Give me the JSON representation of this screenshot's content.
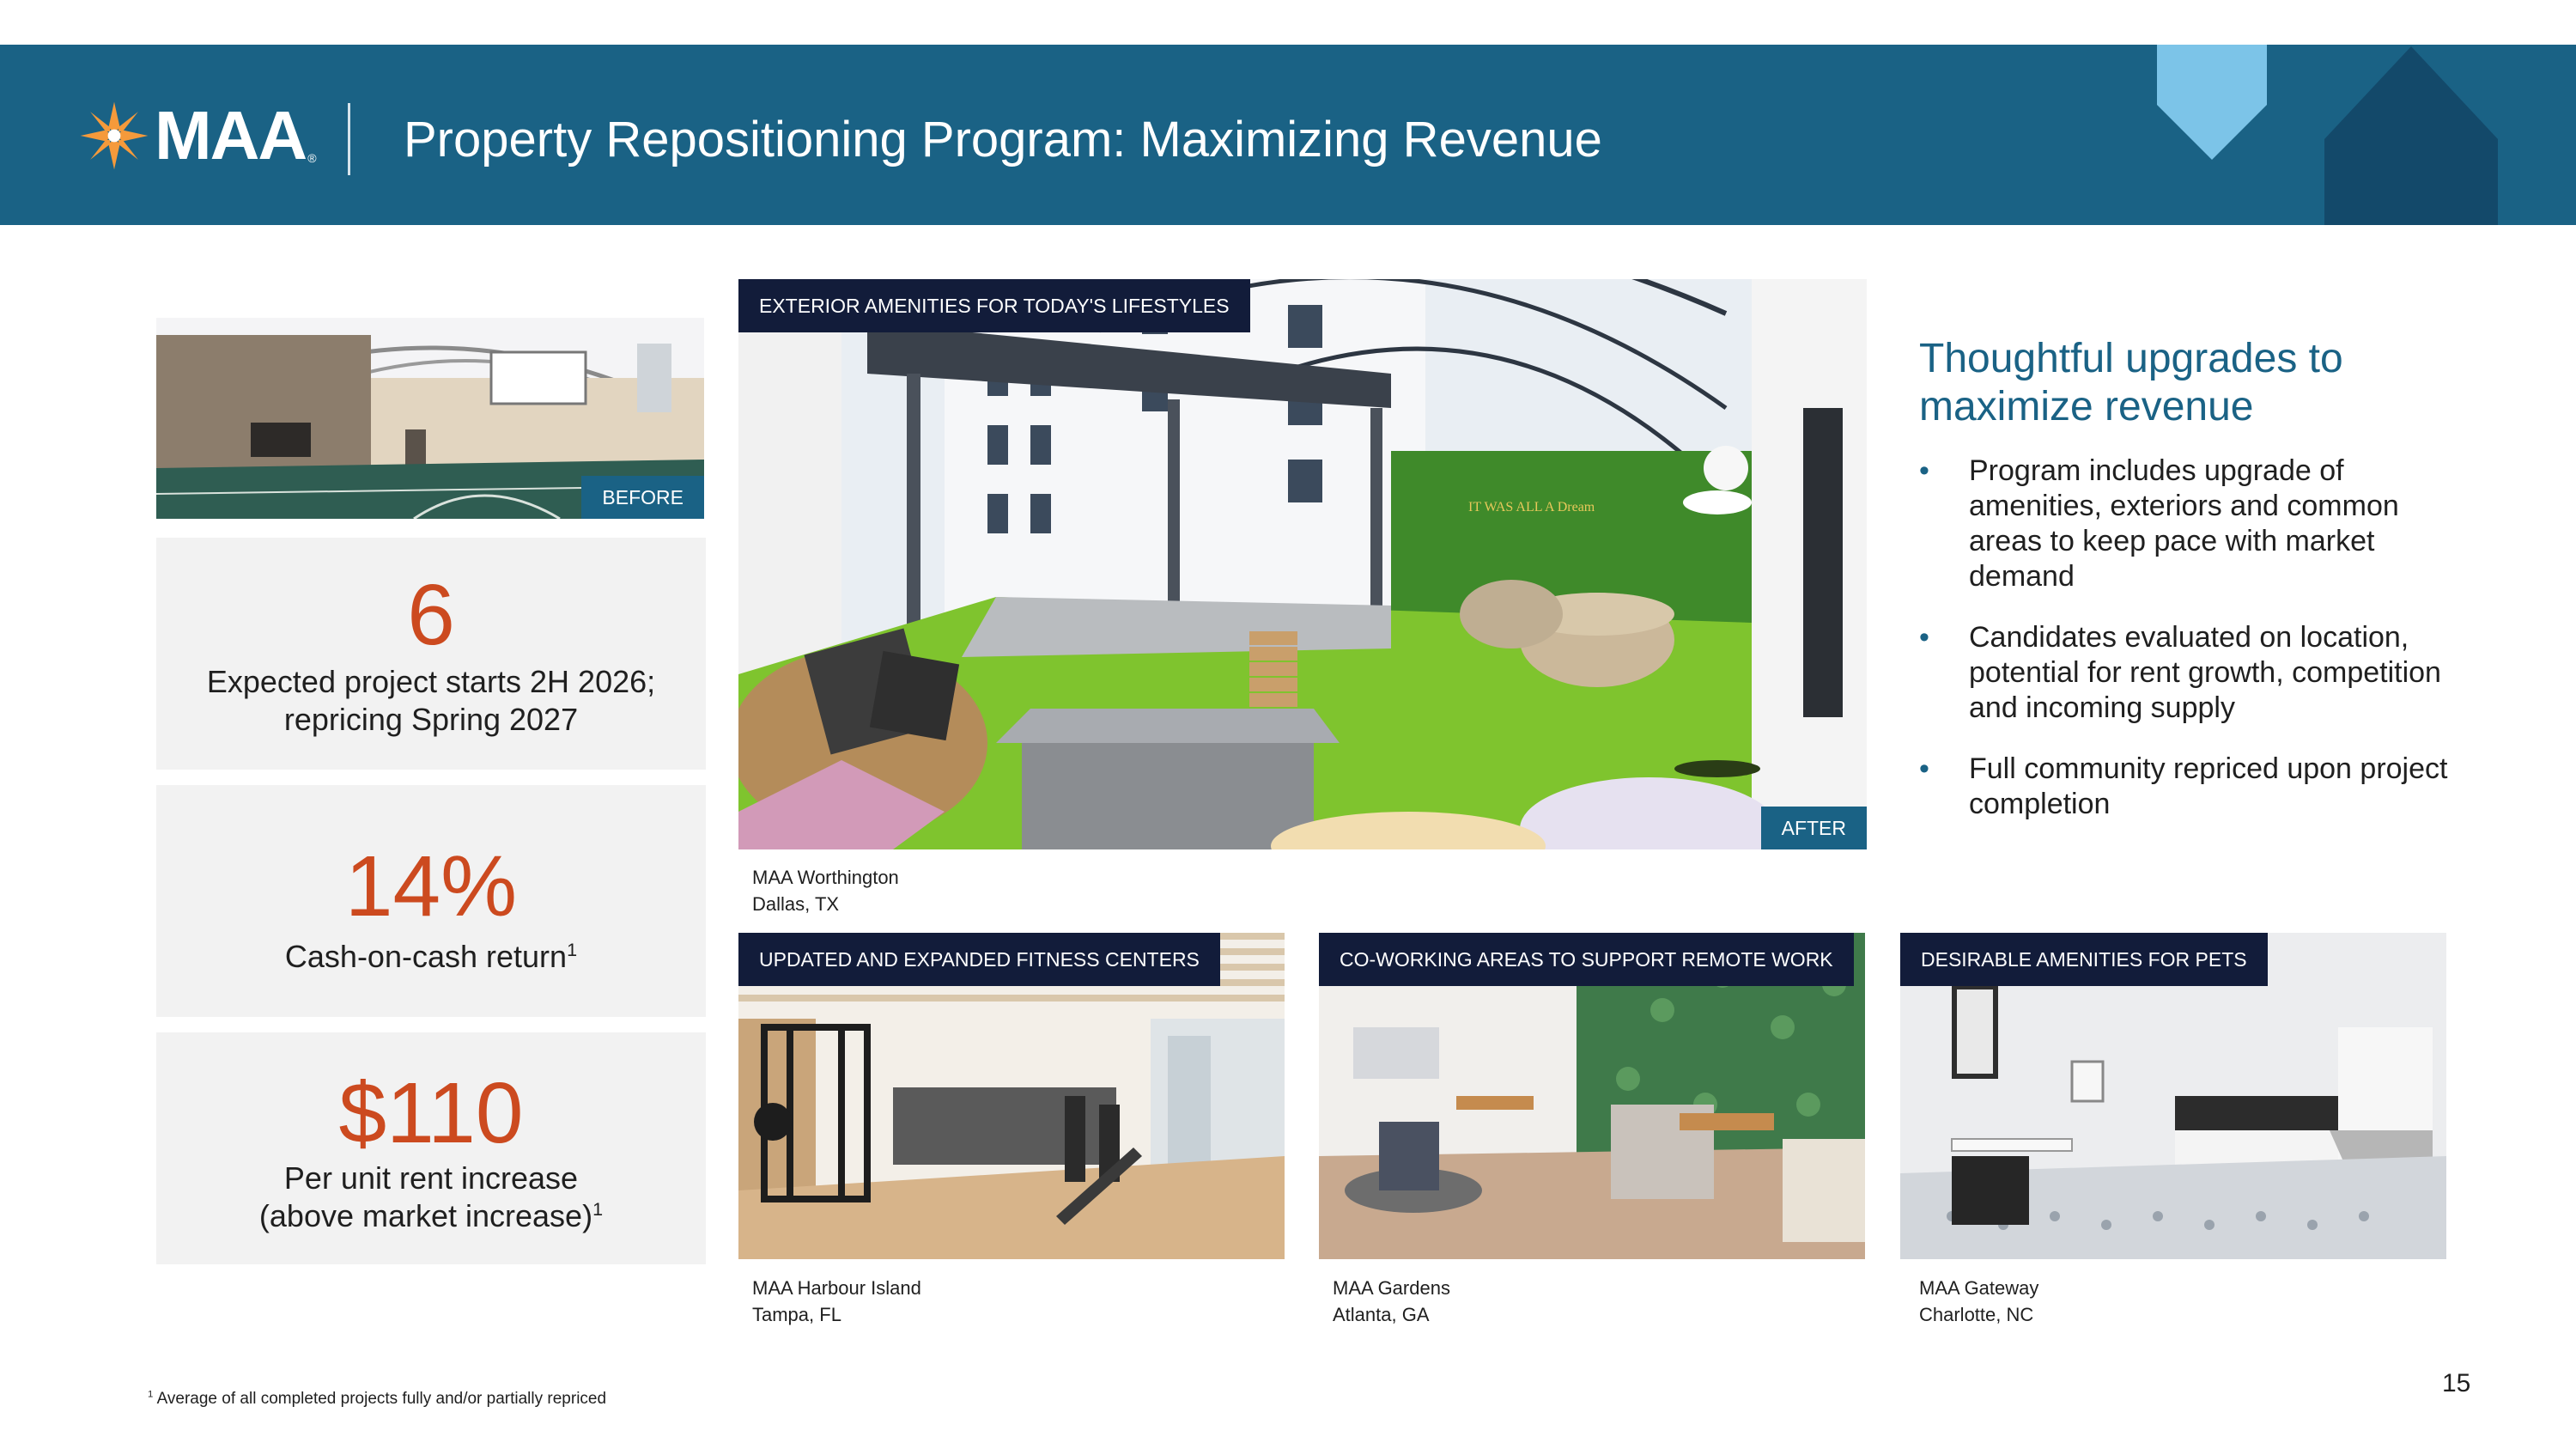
{
  "brand": {
    "name": "MAA",
    "trademark": "®",
    "accent": "#1a6285",
    "highlight": "#cc4a1f",
    "logo_mark_color": "#f59a3b"
  },
  "header": {
    "title": "Property Repositioning Program: Maximizing Revenue"
  },
  "before_photo": {
    "tag": "BEFORE"
  },
  "hero": {
    "label": "EXTERIOR AMENITIES FOR TODAY'S LIFESTYLES",
    "tag": "AFTER",
    "wall_sign": "IT WAS ALL A Dream",
    "caption_line1": "MAA Worthington",
    "caption_line2": "Dallas, TX"
  },
  "stats": [
    {
      "value": "6",
      "label_line1": "Expected project starts 2H 2026;",
      "label_line2": "repricing Spring 2027"
    },
    {
      "value": "14%",
      "label_line1": "Cash-on-cash return",
      "sup1": "1"
    },
    {
      "value": "$110",
      "label_line1": "Per unit rent increase",
      "label_line2": "(above market increase)",
      "sup2": "1"
    }
  ],
  "right": {
    "heading": "Thoughtful upgrades to maximize revenue",
    "bullets": [
      "Program includes upgrade of amenities, exteriors and common areas to keep pace with market demand",
      "Candidates evaluated on location, potential for rent growth, competition and incoming supply",
      "Full community repriced upon project completion"
    ]
  },
  "gallery": [
    {
      "label": "UPDATED AND EXPANDED FITNESS CENTERS",
      "caption_line1": "MAA Harbour Island",
      "caption_line2": "Tampa, FL"
    },
    {
      "label": "CO-WORKING AREAS TO SUPPORT REMOTE WORK",
      "caption_line1": "MAA Gardens",
      "caption_line2": "Atlanta, GA"
    },
    {
      "label": "DESIRABLE AMENITIES FOR PETS",
      "caption_line1": "MAA Gateway",
      "caption_line2": "Charlotte, NC"
    }
  ],
  "footnote": {
    "mark": "1",
    "text": " Average of all completed projects fully and/or partially repriced"
  },
  "page_number": "15"
}
